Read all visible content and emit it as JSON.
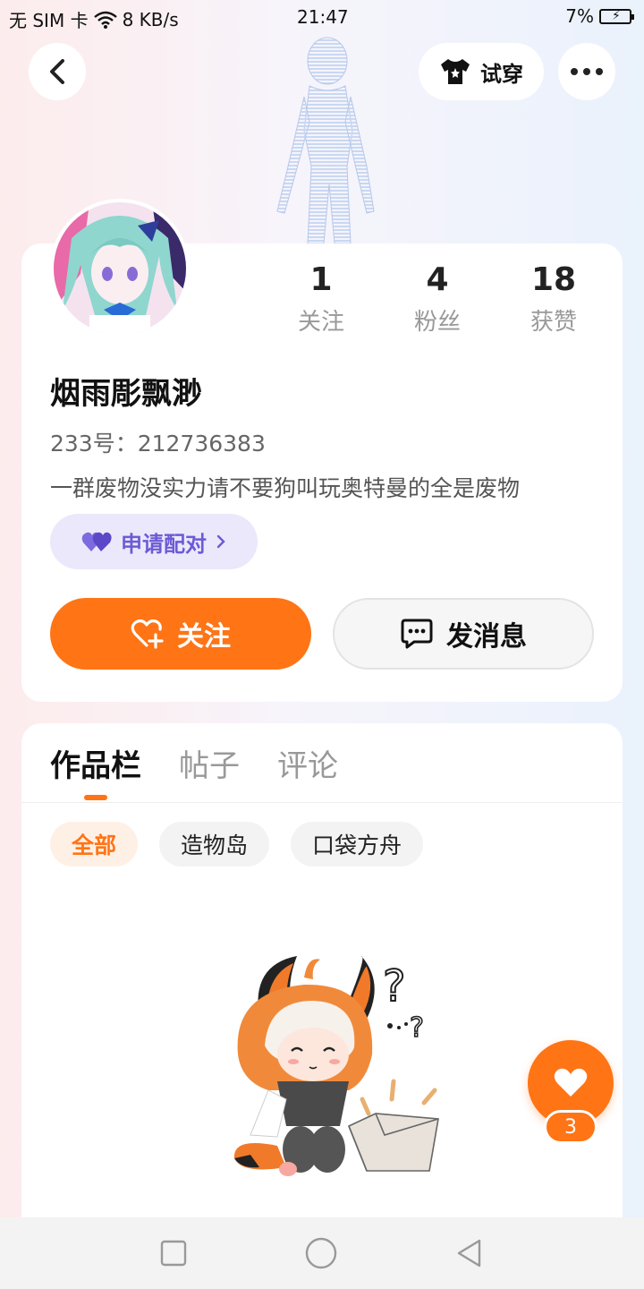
{
  "status_bar": {
    "carrier": "无 SIM 卡",
    "speed": "8 KB/s",
    "time": "21:47",
    "battery": "7%"
  },
  "header": {
    "try_on_label": "试穿"
  },
  "profile": {
    "stats": [
      {
        "value": "1",
        "label": "关注"
      },
      {
        "value": "4",
        "label": "粉丝"
      },
      {
        "value": "18",
        "label": "获赞"
      }
    ],
    "username": "烟雨彫飘渺",
    "uid": "233号：212736383",
    "bio": "一群废物没实力请不要狗叫玩奥特曼的全是废物",
    "match_label": "申请配对",
    "follow_label": "关注",
    "message_label": "发消息"
  },
  "content": {
    "tabs": [
      "作品栏",
      "帖子",
      "评论"
    ],
    "active_tab": 0,
    "chips": [
      "全部",
      "造物岛",
      "口袋方舟"
    ],
    "active_chip": 0
  },
  "floating_like": {
    "count": "3"
  },
  "colors": {
    "accent": "#ff7415",
    "match_purple": "#6b5bd6",
    "match_bg": "#ebe8fb"
  }
}
